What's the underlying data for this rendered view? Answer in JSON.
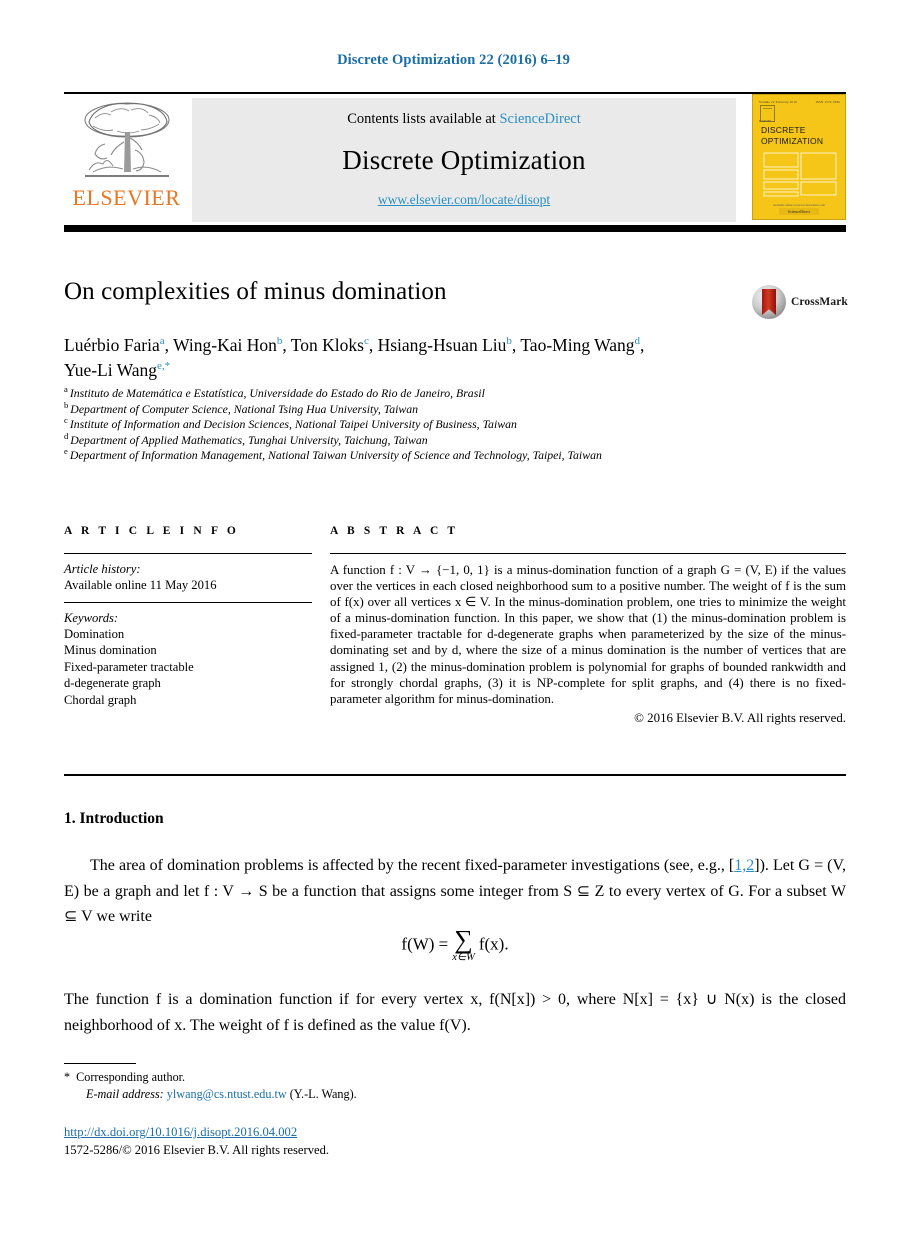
{
  "running_head": "Discrete Optimization 22 (2016) 6–19",
  "masthead": {
    "contents_prefix": "Contents lists available at ",
    "contents_link": "ScienceDirect",
    "journal_title": "Discrete Optimization",
    "journal_url": "www.elsevier.com/locate/disopt",
    "publisher": "ELSEVIER",
    "cover": {
      "volume_line": "Volume 22  February 2016",
      "issn_line": "ISSN 1572-5286",
      "brand": "ELSEVIER",
      "title_line1": "DISCRETE",
      "title_line2": "OPTIMIZATION",
      "footer_small": "Available online at www.sciencedirect.com",
      "footer_badge": "ScienceDirect"
    }
  },
  "crossmark": {
    "label": "CrossMark"
  },
  "title": "On complexities of minus domination",
  "authors": {
    "line1": [
      {
        "name": "Luérbio Faria",
        "mark": "a",
        "sep": ", "
      },
      {
        "name": "Wing-Kai Hon",
        "mark": "b",
        "sep": ", "
      },
      {
        "name": "Ton Kloks",
        "mark": "c",
        "sep": ", "
      },
      {
        "name": "Hsiang-Hsuan Liu",
        "mark": "b",
        "sep": ", "
      },
      {
        "name": "Tao-Ming Wang",
        "mark": "d",
        "sep": ","
      }
    ],
    "line2": [
      {
        "name": "Yue-Li Wang",
        "mark": "e,*",
        "sep": ""
      }
    ]
  },
  "affiliations": [
    {
      "mark": "a",
      "text": "Instituto de Matemática e Estatística, Universidade do Estado do Rio de Janeiro, Brasil"
    },
    {
      "mark": "b",
      "text": "Department of Computer Science, National Tsing Hua University, Taiwan"
    },
    {
      "mark": "c",
      "text": "Institute of Information and Decision Sciences, National Taipei University of Business, Taiwan"
    },
    {
      "mark": "d",
      "text": "Department of Applied Mathematics, Tunghai University, Taichung, Taiwan"
    },
    {
      "mark": "e",
      "text": "Department of Information Management, National Taiwan University of Science and Technology, Taipei, Taiwan"
    }
  ],
  "article_info": {
    "heading": "A R T I C L E   I N F O",
    "history_label": "Article history:",
    "history_value": "Available online 11 May 2016",
    "keywords_label": "Keywords:",
    "keywords": [
      "Domination",
      "Minus domination",
      "Fixed-parameter tractable",
      "d-degenerate graph",
      "Chordal graph"
    ]
  },
  "abstract": {
    "heading": "A B S T R A C T",
    "text": "A function f : V → {−1, 0, 1} is a minus-domination function of a graph G = (V, E) if the values over the vertices in each closed neighborhood sum to a positive number. The weight of f is the sum of f(x) over all vertices x ∈ V. In the minus-domination problem, one tries to minimize the weight of a minus-domination function. In this paper, we show that (1) the minus-domination problem is fixed-parameter tractable for d-degenerate graphs when parameterized by the size of the minus-dominating set and by d, where the size of a minus domination is the number of vertices that are assigned 1, (2) the minus-domination problem is polynomial for graphs of bounded rankwidth and for strongly chordal graphs, (3) it is NP-complete for split graphs, and (4) there is no fixed-parameter algorithm for minus-domination.",
    "copyright": "© 2016 Elsevier B.V. All rights reserved."
  },
  "section": {
    "heading": "1. Introduction",
    "paragraph1_a": "The area of domination problems is affected by the recent fixed-parameter investigations (see, e.g., [",
    "paragraph1_cite": "1,2",
    "paragraph1_b": "]). Let G = (V, E) be a graph and let f : V → S be a function that assigns some integer from S ⊆ Z to every vertex of G. For a subset W ⊆ V we write",
    "equation_lhs": "f(W) =",
    "equation_sum": "∑",
    "equation_sub": "x∈W",
    "equation_rhs": "f(x).",
    "paragraph2": "The function f is a domination function if for every vertex x, f(N[x]) > 0, where N[x] = {x} ∪ N(x) is the closed neighborhood of x. The weight of f is defined as the value f(V)."
  },
  "footnotes": {
    "corresponding_star": "*",
    "corresponding_text": "Corresponding author.",
    "email_label": "E-mail address:",
    "email": "ylwang@cs.ntust.edu.tw",
    "email_suffix": "(Y.-L. Wang).",
    "doi": "http://dx.doi.org/10.1016/j.disopt.2016.04.002",
    "issn_line": "1572-5286/© 2016 Elsevier B.V. All rights reserved."
  },
  "colors": {
    "link_blue": "#2a8fc4",
    "header_blue": "#1b6ea5",
    "elsevier_orange": "#e87722",
    "cover_yellow": "#f5c518",
    "band_gray": "#eaeaea"
  }
}
